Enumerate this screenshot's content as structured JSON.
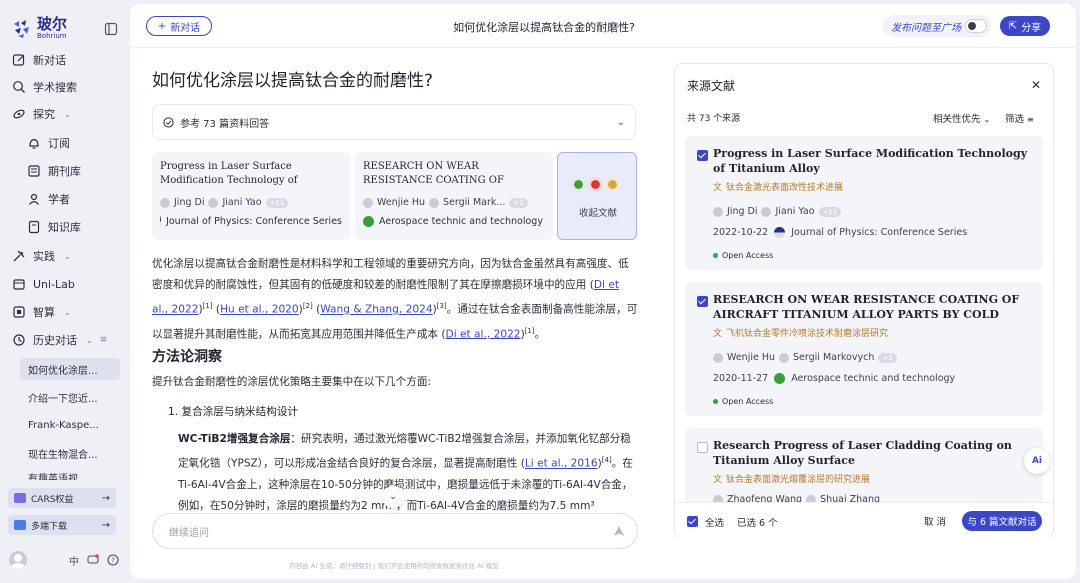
{
  "brand": {
    "name_cn": "玻尔",
    "name_en": "Bohrium"
  },
  "sidebar": {
    "nav": [
      {
        "label": "新对话",
        "icon": "edit-icon"
      },
      {
        "label": "学术搜索",
        "icon": "search-icon"
      },
      {
        "label": "探究",
        "icon": "explore-icon"
      },
      {
        "label": "订阅",
        "icon": "bell-icon"
      },
      {
        "label": "期刊库",
        "icon": "journal-icon"
      },
      {
        "label": "学者",
        "icon": "user-icon"
      },
      {
        "label": "知识库",
        "icon": "book-icon"
      },
      {
        "label": "实践",
        "icon": "practice-icon"
      },
      {
        "label": "Uni-Lab",
        "icon": "lab-icon"
      },
      {
        "label": "智算",
        "icon": "compute-icon"
      },
      {
        "label": "历史对话",
        "icon": "history-icon"
      }
    ],
    "history": [
      "如何优化涂层...",
      "介绍一下您近...",
      "Frank-Kaspe...",
      "现在生物混合...",
      "有趣英语视..."
    ],
    "promo": [
      {
        "label": "CARS权益"
      },
      {
        "label": "多端下载"
      }
    ],
    "lang": "中"
  },
  "topbar": {
    "new_chat": "新对话",
    "title": "如何优化涂层以提高钛合金的耐磨性?",
    "publish": "发布问题至广场",
    "share": "分享"
  },
  "answer": {
    "question": "如何优化涂层以提高钛合金的耐磨性?",
    "ref_summary": "参考 73 篇资料回答",
    "cards": [
      {
        "title": "Progress in Laser Surface Modification Technology of Titanium Alloy",
        "author1": "Jing Di",
        "author2": "Jiani Yao",
        "more": "+11",
        "journal": "Journal of Physics: Conference Series"
      },
      {
        "title": "RESEARCH ON WEAR RESISTANCE COATING OF AIRCRAFT TITANIUM...",
        "author1": "Wenjie Hu",
        "author2": "Sergii Mark...",
        "more": "+3",
        "journal": "Aerospace technic and technology"
      }
    ],
    "fav_label": "收起文献",
    "para1": {
      "t1": "优化涂层以提高钛合金耐磨性是材料科学和工程领域的重要研究方向，因为钛合金虽然具有高强度、低密度和优异的耐腐蚀性，但其固有的低硬度和较差的耐磨性限制了其在摩擦磨损环境中的应用",
      "c1": "Di et al., 2022",
      "s1": "[1]",
      "c2": "Hu et al., 2020",
      "s2": "[2]",
      "c3": "Wang & Zhang, 2024",
      "s3": "[3]",
      "t2": "。通过在钛合金表面制备高性能涂层，可以显著提升其耐磨性能，从而拓宽其应用范围并降低生产成本",
      "c4": "Di et al., 2022",
      "s4": "[1]",
      "t3": "。"
    },
    "section_title": "方法论洞察",
    "section_intro": "提升钛合金耐磨性的涂层优化策略主要集中在以下几个方面:",
    "item1": "1. 复合涂层与纳米结构设计",
    "item1_para": {
      "bold": "WC-TiB2增强复合涂层",
      "t1": "：研究表明，通过激光熔覆WC-TiB2增强复合涂层，并添加氧化钇部分稳定氧化锆（YPSZ），可以形成冶金结合良好的复合涂层，显著提高耐磨性",
      "c1": "Li et al., 2016",
      "s1": "[4]",
      "t2": "。在Ti-6Al-4V合金上，这种涂层在10-50分钟的磨损测试中，磨损量远低于未涂覆的Ti-6Al-4V合金，例如，在50分钟时，涂层的磨损量约为2 mm³，而Ti-6Al-4V合金的磨损量约为7.5 mm³"
    },
    "input_placeholder": "继续追问",
    "disclaimer": "内容由 AI 生成，请仔细甄别 | 我们不会使用你的搜索数据来优化 AI 模型"
  },
  "sources": {
    "title": "来源文献",
    "count": "共 73 个来源",
    "sort": "相关性优先",
    "filter": "筛选",
    "items": [
      {
        "title": "Progress in Laser Surface Modification Technology of Titanium Alloy",
        "translation": "钛合金激光表面改性技术进展",
        "author1": "Jing Di",
        "author2": "Jiani Yao",
        "more": "+11",
        "date": "2022-10-22",
        "journal": "Journal of Physics: Conference Series",
        "oa": "Open Access",
        "checked": true
      },
      {
        "title": "RESEARCH ON WEAR RESISTANCE COATING OF AIRCRAFT TITANIUM ALLOY PARTS BY COLD SPRAYING...",
        "translation": "飞机钛合金零件冷喷涂技术耐磨涂层研究",
        "author1": "Wenjie Hu",
        "author2": "Sergii Markovych",
        "more": "+3",
        "date": "2020-11-27",
        "journal": "Aerospace technic and technology",
        "oa": "Open Access",
        "checked": true
      },
      {
        "title": "Research Progress of Laser Cladding Coating on Titanium Alloy Surface",
        "translation": "钛合金表面激光熔覆涂层的研究进展",
        "author1": "Zhaofeng Wang",
        "author2": "Shuai Zhang",
        "checked": false
      }
    ],
    "select_all": "全选",
    "selected": "已选 6 个",
    "cancel": "取 消",
    "go": "与 6 篇文献对话"
  },
  "fab": "Ai"
}
